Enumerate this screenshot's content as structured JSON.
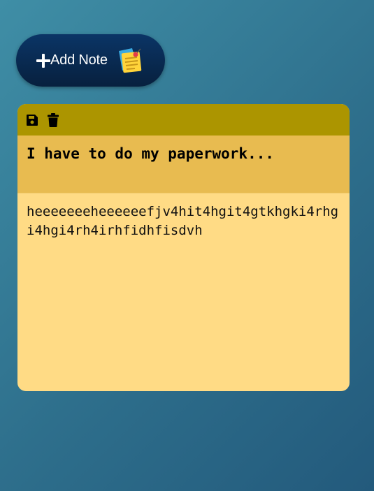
{
  "add_button": {
    "label": "Add Note",
    "plus_icon": "plus-icon",
    "sticky_icon": "sticky-note-icon"
  },
  "note": {
    "toolbar": {
      "save_icon": "save-icon",
      "delete_icon": "trash-icon"
    },
    "title": "I have to do my paperwork...",
    "body": "heeeeeeeheeeeeefjv4hit4hgit4gtkhgki4rhgi4hgi4rh4irhfidhfisdvh"
  },
  "colors": {
    "toolbar": "#ac9500",
    "title_bg": "#e8bb50",
    "body_bg": "#ffdb85",
    "button_bg": "#07203e"
  }
}
